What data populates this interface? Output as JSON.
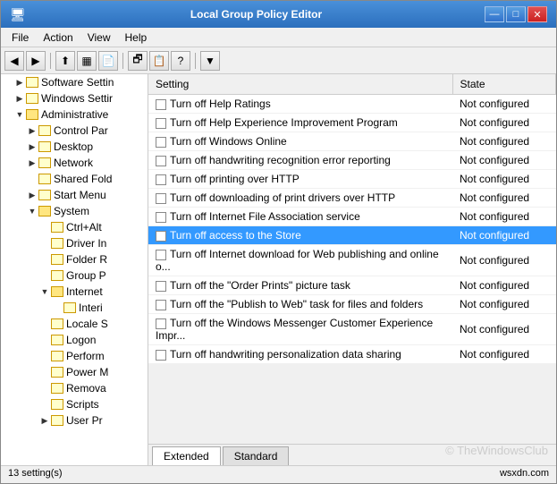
{
  "window": {
    "title": "Local Group Policy Editor",
    "controls": {
      "minimize": "—",
      "maximize": "□",
      "close": "✕"
    }
  },
  "menubar": {
    "items": [
      "File",
      "Action",
      "View",
      "Help"
    ]
  },
  "toolbar": {
    "buttons": [
      "◀",
      "▶",
      "⬆",
      "▦",
      "⬛",
      "▩",
      "↑",
      "▦",
      "▣",
      "▼"
    ]
  },
  "tree": {
    "items": [
      {
        "label": "Software Settin",
        "indent": 1,
        "expand": "▶",
        "open": false
      },
      {
        "label": "Windows Settir",
        "indent": 1,
        "expand": "▶",
        "open": false
      },
      {
        "label": "Administrative",
        "indent": 1,
        "expand": "▼",
        "open": true
      },
      {
        "label": "Control Par",
        "indent": 2,
        "expand": "▶",
        "open": false
      },
      {
        "label": "Desktop",
        "indent": 2,
        "expand": "▶",
        "open": false
      },
      {
        "label": "Network",
        "indent": 2,
        "expand": "▶",
        "open": false
      },
      {
        "label": "Shared Fold",
        "indent": 2,
        "expand": "",
        "open": false
      },
      {
        "label": "Start Menu",
        "indent": 2,
        "expand": "▶",
        "open": false
      },
      {
        "label": "System",
        "indent": 2,
        "expand": "▼",
        "open": true
      },
      {
        "label": "Ctrl+Alt",
        "indent": 3,
        "expand": "",
        "open": false
      },
      {
        "label": "Driver In",
        "indent": 3,
        "expand": "",
        "open": false
      },
      {
        "label": "Folder R",
        "indent": 3,
        "expand": "",
        "open": false
      },
      {
        "label": "Group P",
        "indent": 3,
        "expand": "",
        "open": false
      },
      {
        "label": "Internet",
        "indent": 3,
        "expand": "▼",
        "open": true
      },
      {
        "label": "Interi",
        "indent": 4,
        "expand": "",
        "open": false
      },
      {
        "label": "Locale S",
        "indent": 3,
        "expand": "",
        "open": false
      },
      {
        "label": "Logon",
        "indent": 3,
        "expand": "",
        "open": false
      },
      {
        "label": "Perform",
        "indent": 3,
        "expand": "",
        "open": false
      },
      {
        "label": "Power M",
        "indent": 3,
        "expand": "",
        "open": false
      },
      {
        "label": "Remova",
        "indent": 3,
        "expand": "",
        "open": false
      },
      {
        "label": "Scripts",
        "indent": 3,
        "expand": "",
        "open": false
      },
      {
        "label": "User Pr",
        "indent": 3,
        "expand": "▶",
        "open": false
      }
    ]
  },
  "table": {
    "columns": [
      "Setting",
      "State"
    ],
    "rows": [
      {
        "setting": "Turn off Help Ratings",
        "state": "Not configured",
        "selected": false
      },
      {
        "setting": "Turn off Help Experience Improvement Program",
        "state": "Not configured",
        "selected": false
      },
      {
        "setting": "Turn off Windows Online",
        "state": "Not configured",
        "selected": false
      },
      {
        "setting": "Turn off handwriting recognition error reporting",
        "state": "Not configured",
        "selected": false
      },
      {
        "setting": "Turn off printing over HTTP",
        "state": "Not configured",
        "selected": false
      },
      {
        "setting": "Turn off downloading of print drivers over HTTP",
        "state": "Not configured",
        "selected": false
      },
      {
        "setting": "Turn off Internet File Association service",
        "state": "Not configured",
        "selected": false
      },
      {
        "setting": "Turn off access to the Store",
        "state": "Not configured",
        "selected": true
      },
      {
        "setting": "Turn off Internet download for Web publishing and online o...",
        "state": "Not configured",
        "selected": false
      },
      {
        "setting": "Turn off the \"Order Prints\" picture task",
        "state": "Not configured",
        "selected": false
      },
      {
        "setting": "Turn off the \"Publish to Web\" task for files and folders",
        "state": "Not configured",
        "selected": false
      },
      {
        "setting": "Turn off the Windows Messenger Customer Experience Impr...",
        "state": "Not configured",
        "selected": false
      },
      {
        "setting": "Turn off handwriting personalization data sharing",
        "state": "Not configured",
        "selected": false
      }
    ]
  },
  "tabs": [
    {
      "label": "Extended",
      "active": true
    },
    {
      "label": "Standard",
      "active": false
    }
  ],
  "statusbar": {
    "count": "13 setting(s)",
    "watermark": "© TheWindowsClub",
    "right": "wsxdn.com"
  }
}
